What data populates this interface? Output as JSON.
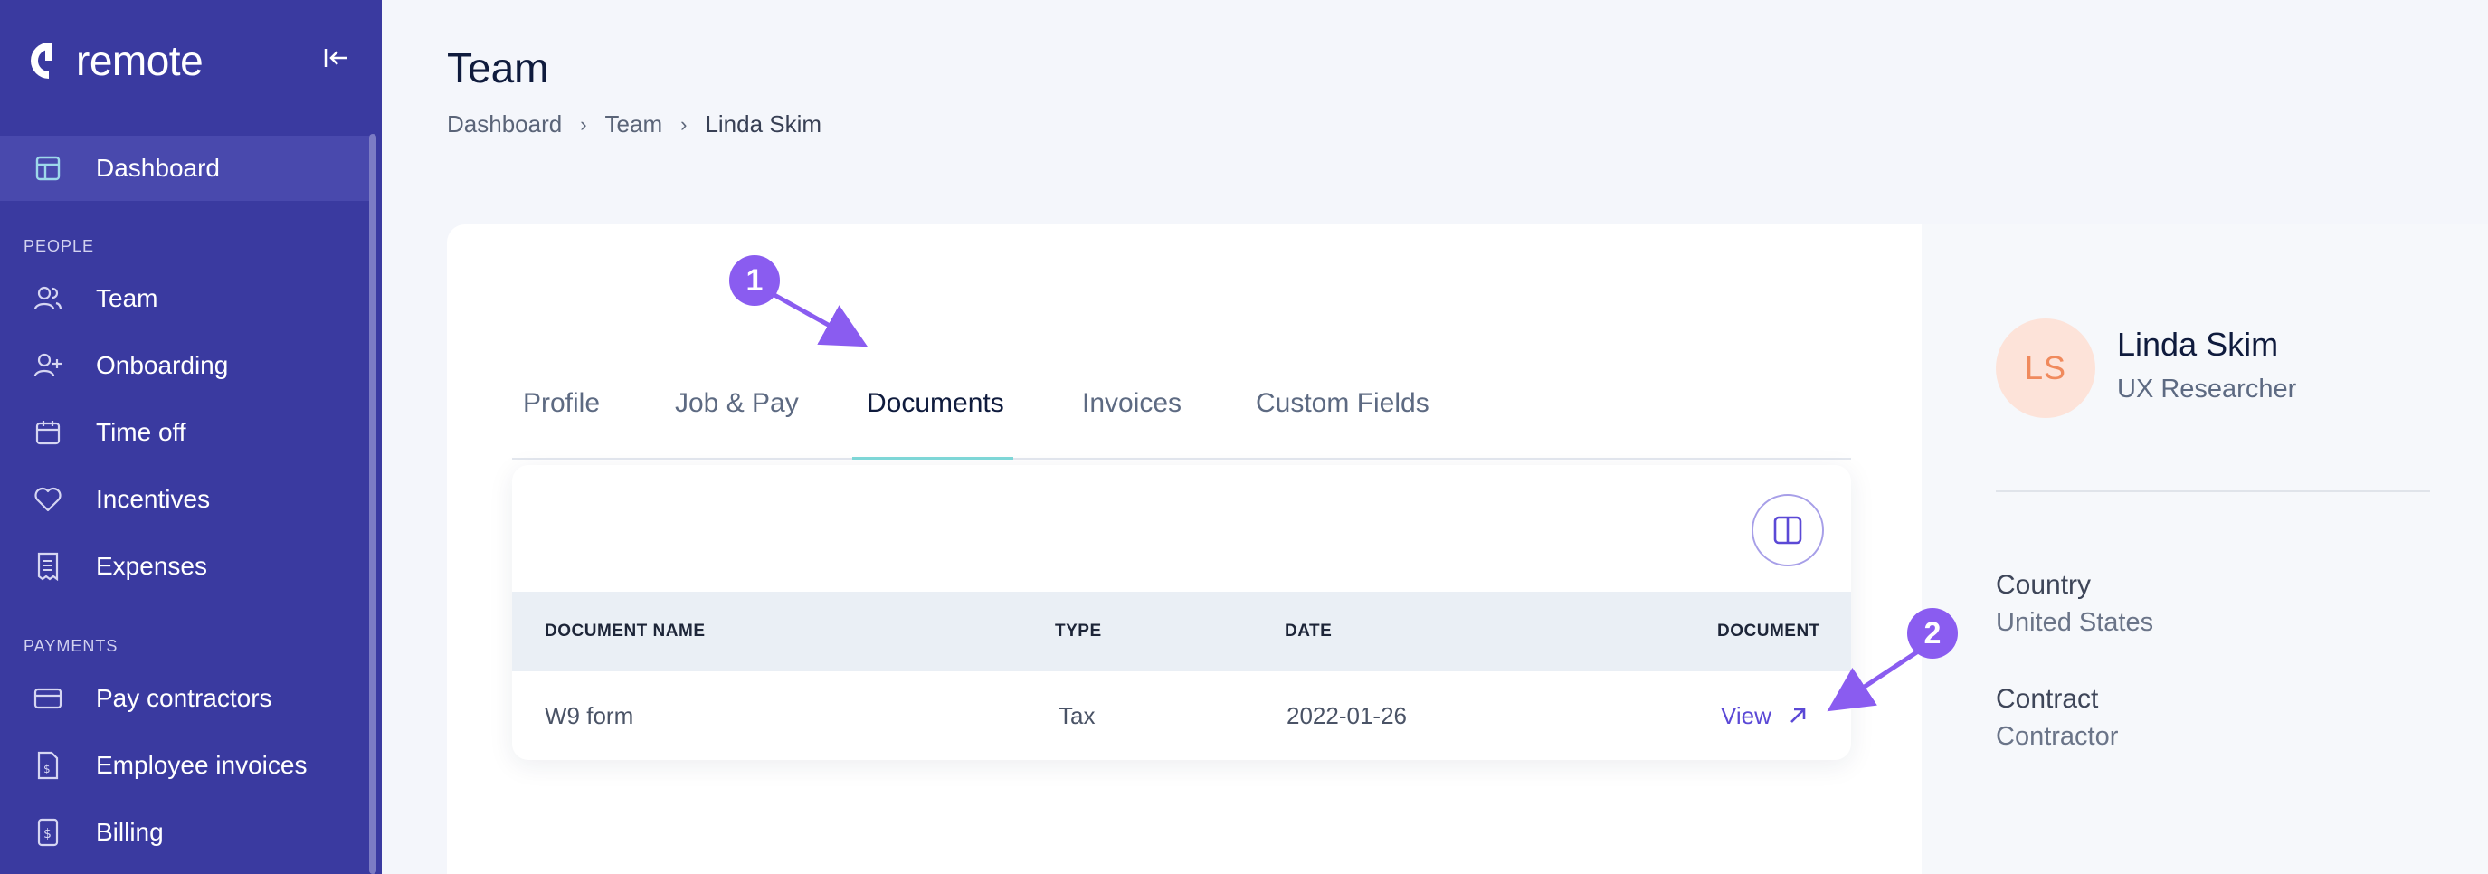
{
  "sidebar": {
    "logo": "remote",
    "items": [
      {
        "label": "Dashboard",
        "icon": "layout-icon"
      },
      {
        "label": "Team",
        "icon": "users-icon"
      },
      {
        "label": "Onboarding",
        "icon": "user-plus-icon"
      },
      {
        "label": "Time off",
        "icon": "calendar-icon"
      },
      {
        "label": "Incentives",
        "icon": "heart-icon"
      },
      {
        "label": "Expenses",
        "icon": "receipt-icon"
      },
      {
        "label": "Pay contractors",
        "icon": "credit-card-icon"
      },
      {
        "label": "Employee invoices",
        "icon": "invoice-icon"
      },
      {
        "label": "Billing",
        "icon": "dollar-document-icon"
      }
    ],
    "sections": {
      "people": "PEOPLE",
      "payments": "PAYMENTS"
    }
  },
  "header": {
    "title": "Team",
    "breadcrumb": [
      "Dashboard",
      "Team",
      "Linda Skim"
    ]
  },
  "tabs": [
    {
      "label": "Profile"
    },
    {
      "label": "Job & Pay"
    },
    {
      "label": "Documents",
      "active": true
    },
    {
      "label": "Invoices"
    },
    {
      "label": "Custom Fields"
    }
  ],
  "documents": {
    "columns": [
      "DOCUMENT NAME",
      "TYPE",
      "DATE",
      "DOCUMENT"
    ],
    "rows": [
      {
        "name": "W9 form",
        "type": "Tax",
        "date": "2022-01-26",
        "action": "View"
      }
    ]
  },
  "profile": {
    "initials": "LS",
    "name": "Linda Skim",
    "role": "UX Researcher",
    "country_label": "Country",
    "country": "United States",
    "contract_label": "Contract",
    "contract": "Contractor"
  },
  "annotations": {
    "step1": "1",
    "step2": "2"
  },
  "colors": {
    "sidebar": "#3a3aa0",
    "accent": "#5b49d6",
    "annotation": "#8a5cf0",
    "tab_underline": "#7fd9d9"
  }
}
